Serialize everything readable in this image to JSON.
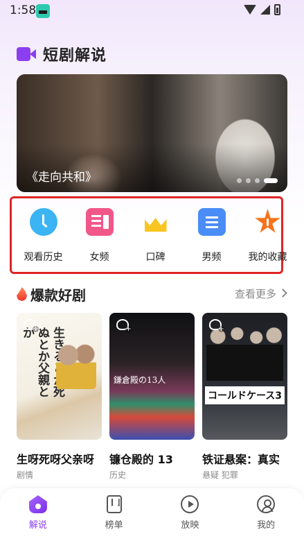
{
  "status_bar": {
    "time": "1:58"
  },
  "header": {
    "title": "短剧解说"
  },
  "banner": {
    "caption": "《走向共和》",
    "dot_count": 4,
    "active_dot": 3
  },
  "categories": [
    {
      "label": "观看历史",
      "icon": "clock-icon"
    },
    {
      "label": "女频",
      "icon": "female-channel-icon"
    },
    {
      "label": "口碑",
      "icon": "crown-icon"
    },
    {
      "label": "男频",
      "icon": "male-channel-icon"
    },
    {
      "label": "我的收藏",
      "icon": "star-icon"
    }
  ],
  "hot_section": {
    "title": "爆款好剧",
    "see_more": "查看更多",
    "dramas": [
      {
        "title": "生呀死呀父亲呀",
        "genre": "剧情",
        "poster_text": "生きるとか死ぬとか父親とか"
      },
      {
        "title": "镰仓殿的 13",
        "genre": "历史",
        "poster_text": "鎌倉殿の13人"
      },
      {
        "title": "铁证悬案：真实",
        "genre": "悬疑 犯罪",
        "poster_text": "コールドケース3"
      }
    ]
  },
  "bottom_nav": [
    {
      "label": "解说",
      "active": true
    },
    {
      "label": "榜单",
      "active": false
    },
    {
      "label": "放映",
      "active": false
    },
    {
      "label": "我的",
      "active": false
    }
  ],
  "colors": {
    "accent": "#8b3ff0",
    "highlight_border": "#e02424",
    "history": "#3ab4f2",
    "female": "#f2578a",
    "crown": "#f9c520",
    "male": "#4a8df6",
    "favorite": "#f7731a"
  }
}
